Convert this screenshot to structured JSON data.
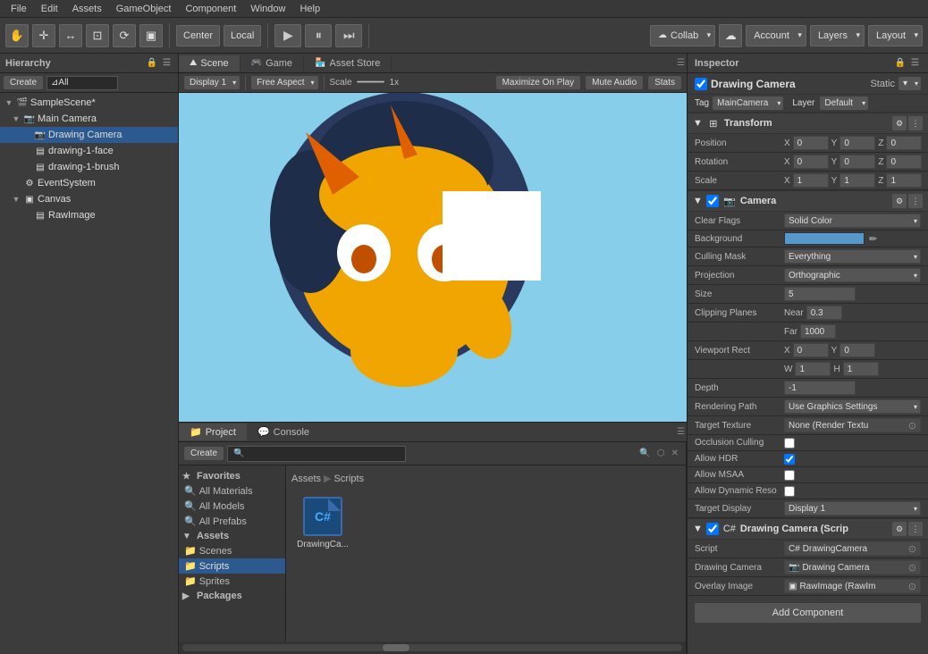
{
  "menubar": {
    "items": [
      "File",
      "Edit",
      "Assets",
      "GameObject",
      "Component",
      "Window",
      "Help"
    ]
  },
  "toolbar": {
    "tools": [
      "✋",
      "✛",
      "↔",
      "⊡",
      "⟳",
      "▣"
    ],
    "center_label": "Center",
    "local_label": "Local",
    "play_btn": "▶",
    "pause_btn": "⏸",
    "step_btn": "⏭",
    "collab_label": "Collab",
    "account_label": "Account",
    "layers_label": "Layers",
    "layout_label": "Layout"
  },
  "hierarchy": {
    "title": "Hierarchy",
    "create_label": "Create",
    "search_placeholder": "⊿All",
    "items": [
      {
        "label": "SampleScene*",
        "indent": 0,
        "arrow": "▼",
        "icon": "🎬"
      },
      {
        "label": "Main Camera",
        "indent": 1,
        "arrow": "▼",
        "icon": "📷"
      },
      {
        "label": "Drawing Camera",
        "indent": 2,
        "arrow": "",
        "icon": "📷",
        "selected": true
      },
      {
        "label": "drawing-1-face",
        "indent": 2,
        "arrow": "",
        "icon": "▤"
      },
      {
        "label": "drawing-1-brush",
        "indent": 2,
        "arrow": "",
        "icon": "▤"
      },
      {
        "label": "EventSystem",
        "indent": 1,
        "arrow": "",
        "icon": "⚙"
      },
      {
        "label": "Canvas",
        "indent": 1,
        "arrow": "▼",
        "icon": "▣"
      },
      {
        "label": "RawImage",
        "indent": 2,
        "arrow": "",
        "icon": "▤"
      }
    ]
  },
  "scene": {
    "tabs": [
      "Scene",
      "Game",
      "Asset Store"
    ],
    "toolbar": {
      "display": "Display 1",
      "aspect": "Free Aspect",
      "scale_label": "Scale",
      "scale_value": "1x",
      "maximize_label": "Maximize On Play",
      "mute_label": "Mute Audio",
      "stats_label": "Stats"
    }
  },
  "project": {
    "title": "Project",
    "console_label": "Console",
    "create_label": "Create",
    "search_placeholder": "",
    "breadcrumb": [
      "Assets",
      "Scripts"
    ],
    "sidebar": {
      "favorites_label": "Favorites",
      "favorites_items": [
        "All Materials",
        "All Models",
        "All Prefabs"
      ],
      "assets_label": "Assets",
      "assets_items": [
        "Scenes",
        "Scripts",
        "Sprites"
      ],
      "packages_label": "Packages"
    },
    "files": [
      {
        "name": "DrawingCa...",
        "icon": "C#"
      }
    ]
  },
  "inspector": {
    "title": "Inspector",
    "object_name": "Drawing Camera",
    "static_label": "Static",
    "tag_label": "Tag",
    "tag_value": "MainCamera",
    "layer_label": "Layer",
    "layer_value": "Default",
    "transform": {
      "title": "Transform",
      "position": {
        "label": "Position",
        "x": "0",
        "y": "0",
        "z": "0"
      },
      "rotation": {
        "label": "Rotation",
        "x": "0",
        "y": "0",
        "z": "0"
      },
      "scale": {
        "label": "Scale",
        "x": "1",
        "y": "1",
        "z": "1"
      }
    },
    "camera": {
      "title": "Camera",
      "clear_flags": {
        "label": "Clear Flags",
        "value": "Solid Color"
      },
      "background": {
        "label": "Background"
      },
      "culling_mask": {
        "label": "Culling Mask",
        "value": "Everything"
      },
      "projection": {
        "label": "Projection",
        "value": "Orthographic"
      },
      "size": {
        "label": "Size",
        "value": "5"
      },
      "clipping_near": {
        "label": "Near",
        "value": "0.3"
      },
      "clipping_far": {
        "label": "Far",
        "value": "1000"
      },
      "clipping_label": "Clipping Planes",
      "viewport_label": "Viewport Rect",
      "viewport_x": "0",
      "viewport_y": "0",
      "viewport_w": "1",
      "viewport_h": "1",
      "depth": {
        "label": "Depth",
        "value": "-1"
      },
      "rendering_path": {
        "label": "Rendering Path",
        "value": "Use Graphics Settings"
      },
      "target_texture": {
        "label": "Target Texture",
        "value": "None (Render Textu"
      },
      "occlusion_culling": {
        "label": "Occlusion Culling"
      },
      "allow_hdr": {
        "label": "Allow HDR"
      },
      "allow_msaa": {
        "label": "Allow MSAA"
      },
      "allow_dynamic": {
        "label": "Allow Dynamic Reso"
      },
      "target_display": {
        "label": "Target Display",
        "value": "Display 1"
      }
    },
    "drawing_camera_script": {
      "title": "Drawing Camera (Scrip",
      "script_label": "Script",
      "script_value": "DrawingCamera",
      "drawing_camera_label": "Drawing Camera",
      "drawing_camera_value": "Drawing Camera",
      "overlay_image_label": "Overlay Image",
      "overlay_image_value": "RawImage (RawIm"
    },
    "add_component_label": "Add Component"
  }
}
